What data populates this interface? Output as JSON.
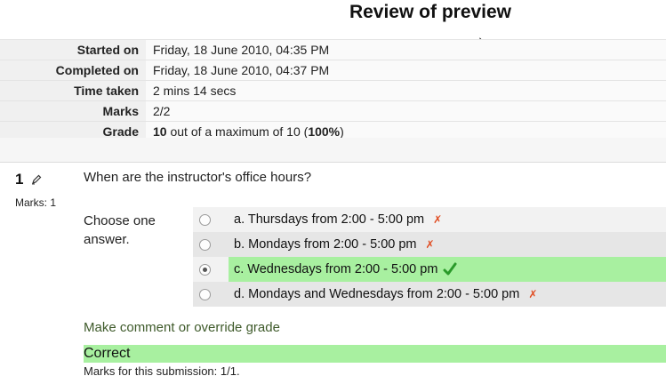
{
  "page": {
    "title": "Review of preview"
  },
  "summary": [
    {
      "label": "Started on",
      "value": "Friday, 18 June 2010, 04:35 PM"
    },
    {
      "label": "Completed on",
      "value": "Friday, 18 June 2010, 04:37 PM"
    },
    {
      "label": "Time taken",
      "value": "2 mins 14 secs"
    },
    {
      "label": "Marks",
      "value": "2/2"
    },
    {
      "label": "Grade",
      "value_strong": "10",
      "value_mid": " out of a maximum of 10 (",
      "value_pct": "100%",
      "value_end": ")"
    }
  ],
  "question": {
    "number": "1",
    "marks": "Marks: 1",
    "text": "When are the instructor's office hours?",
    "prompt": "Choose one answer.",
    "answers": [
      {
        "label": "a. Thursdays from 2:00 - 5:00 pm",
        "correct": false,
        "selected": false,
        "mark": "✗"
      },
      {
        "label": "b. Mondays from 2:00 - 5:00 pm",
        "correct": false,
        "selected": false,
        "mark": "✗"
      },
      {
        "label": "c. Wednesdays from 2:00 - 5:00 pm",
        "correct": true,
        "selected": true,
        "mark": "✓"
      },
      {
        "label": "d. Mondays and Wednesdays from 2:00 - 5:00 pm",
        "correct": false,
        "selected": false,
        "mark": "✗"
      }
    ],
    "comment_link": "Make comment or override grade",
    "feedback": "Correct",
    "submission_marks": "Marks for this submission: 1/1."
  },
  "colors": {
    "correct_bg": "#a8f0a0",
    "incorrect_mark": "#e04a1f",
    "check_mark": "#2a9a2a",
    "link": "#3e5a2a"
  }
}
